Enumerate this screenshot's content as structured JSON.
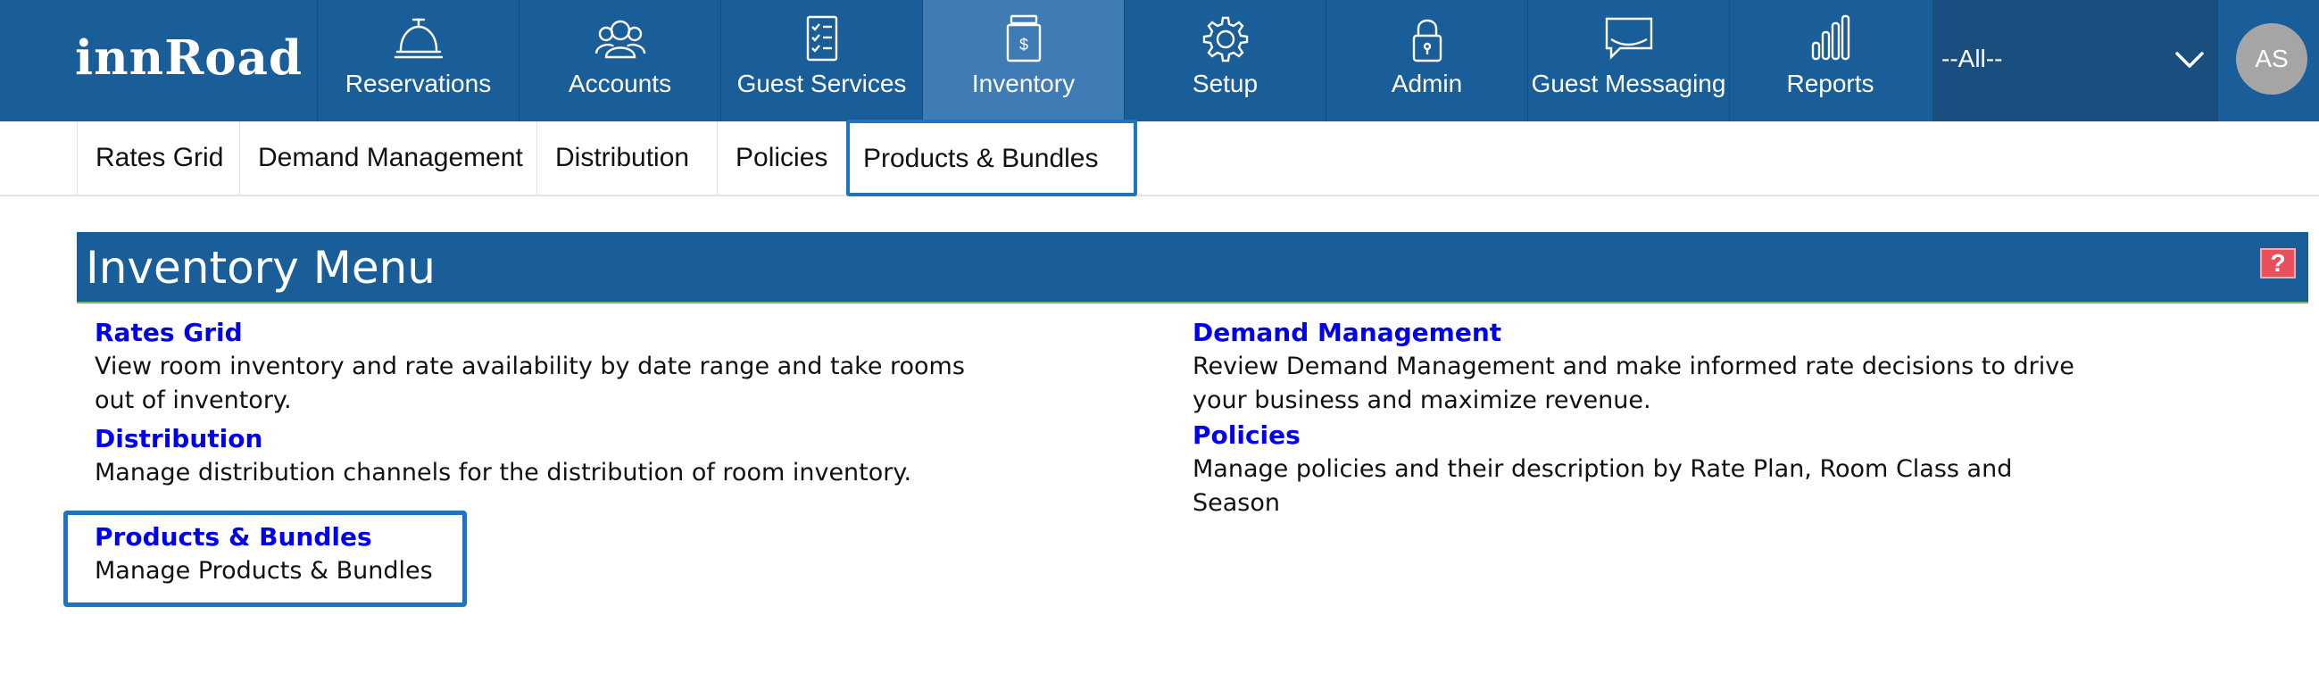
{
  "brand": {
    "logo_text": "innRoad"
  },
  "nav": {
    "items": [
      {
        "label": "Reservations",
        "icon": "bell-icon"
      },
      {
        "label": "Accounts",
        "icon": "users-icon"
      },
      {
        "label": "Guest Services",
        "icon": "checklist-icon"
      },
      {
        "label": "Inventory",
        "icon": "inventory-icon"
      },
      {
        "label": "Setup",
        "icon": "gear-icon"
      },
      {
        "label": "Admin",
        "icon": "lock-icon"
      },
      {
        "label": "Guest Messaging",
        "icon": "message-icon"
      },
      {
        "label": "Reports",
        "icon": "bar-chart-icon"
      }
    ],
    "active": "Inventory",
    "property_select": {
      "value": "--All--"
    },
    "avatar_initials": "AS"
  },
  "subnav": {
    "tabs": [
      {
        "label": "Rates Grid"
      },
      {
        "label": "Demand Management"
      },
      {
        "label": "Distribution"
      },
      {
        "label": "Policies"
      },
      {
        "label": "Products & Bundles"
      }
    ]
  },
  "panel": {
    "title": "Inventory Menu",
    "help_label": "?",
    "items": [
      {
        "title": "Rates Grid",
        "description": "View room inventory and rate availability by date range and take rooms out of inventory."
      },
      {
        "title": "Demand Management",
        "description": "Review Demand Management and make informed rate decisions to drive your business and maximize revenue."
      },
      {
        "title": "Distribution",
        "description": "Manage distribution channels for the distribution of room inventory."
      },
      {
        "title": "Policies",
        "description": "Manage policies and their description by Rate Plan, Room Class and Season"
      },
      {
        "title": "Products & Bundles",
        "description": "Manage Products & Bundles"
      }
    ]
  },
  "colors": {
    "nav_bg": "#195d99",
    "nav_active": "#3f7bb5",
    "link": "#0000ee",
    "highlight": "#1e74c0",
    "help_bg": "#e8505b"
  }
}
